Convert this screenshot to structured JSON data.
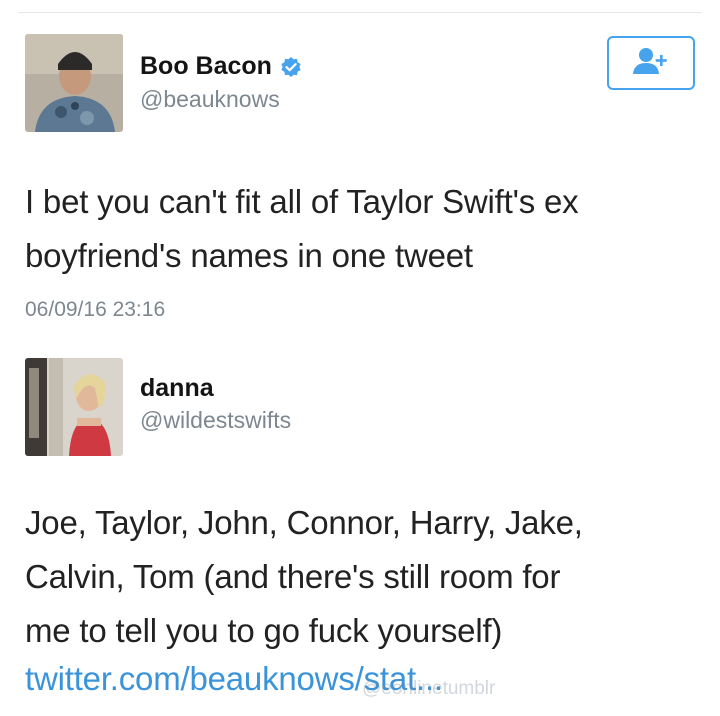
{
  "tweet": {
    "author_name": "Boo Bacon",
    "author_handle": "@beauknows",
    "text_line1": "I bet you can't fit all of Taylor Swift's ex",
    "text_line2": "boyfriend's names in one tweet",
    "timestamp": "06/09/16 23:16",
    "verified_icon": "verified-check-icon",
    "follow_icon": "add-user-icon"
  },
  "reply": {
    "author_name": "danna",
    "author_handle": "@wildestswifts",
    "text_line1": "Joe, Taylor, John, Connor, Harry, Jake,",
    "text_line2": "Calvin, Tom (and there's still room for",
    "text_line3": "me to tell you to go fuck yourself)",
    "link": "twitter.com/beauknows/stat...",
    "watermark": "@eonlinetumblr"
  },
  "colors": {
    "accent_blue": "#46a3ec",
    "link_blue": "#3b94d9",
    "secondary_text": "#7d8790"
  }
}
